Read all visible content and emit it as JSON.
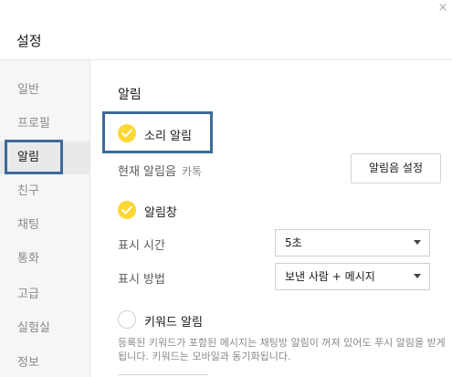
{
  "window": {
    "title": "설정",
    "close_glyph": "×"
  },
  "sidebar": {
    "items": [
      {
        "label": "일반"
      },
      {
        "label": "프로필"
      },
      {
        "label": "알림"
      },
      {
        "label": "친구"
      },
      {
        "label": "채팅"
      },
      {
        "label": "통화"
      },
      {
        "label": "고급"
      },
      {
        "label": "실험실"
      },
      {
        "label": "정보"
      }
    ],
    "selected": "알림"
  },
  "notifications": {
    "section_title": "알림",
    "sound_alert": {
      "label": "소리 알림",
      "checked": true
    },
    "current_sound": {
      "label": "현재 알림음",
      "value": "카톡"
    },
    "sound_settings_button": "알림음 설정",
    "alert_window": {
      "label": "알림창",
      "checked": true
    },
    "display_time": {
      "label": "표시 시간",
      "value": "5초"
    },
    "display_method": {
      "label": "표시 방법",
      "value": "보낸 사람 + 메시지"
    },
    "keyword_alert": {
      "label": "키워드 알림",
      "checked": false
    },
    "keyword_description": "등록된 키워드가 포함된 메시지는 채팅방 알림이 꺼져 있어도 푸시 알림을 받게됩니다. 키워드는 모바일과 동기화됩니다."
  },
  "colors": {
    "accent": "#fdd835",
    "highlight_box": "#3e6a99",
    "sidebar_bg": "#f6f6f6"
  }
}
